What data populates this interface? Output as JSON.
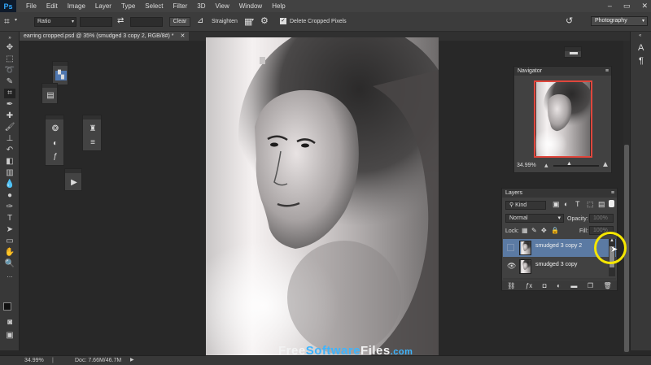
{
  "app": {
    "logo": "Ps"
  },
  "menu": [
    "File",
    "Edit",
    "Image",
    "Layer",
    "Type",
    "Select",
    "Filter",
    "3D",
    "View",
    "Window",
    "Help"
  ],
  "window_controls": [
    "–",
    "▭",
    "✕"
  ],
  "options_bar": {
    "ratio_select": "Ratio",
    "clear_label": "Clear",
    "straighten_label": "Straighten",
    "delete_cropped_label": "Delete Cropped Pixels",
    "delete_cropped_checked": true,
    "workspace": "Photography"
  },
  "document_tab": {
    "title": "earring cropped.psd @ 35% (smudged 3 copy 2, RGB/8#) *",
    "close": "✕"
  },
  "navigator": {
    "title": "Navigator",
    "zoom": "34.99%"
  },
  "layers": {
    "title": "Layers",
    "kind_filter": "Kind",
    "blend_mode": "Normal",
    "opacity_label": "Opacity:",
    "opacity_value": "100%",
    "lock_label": "Lock:",
    "fill_label": "Fill:",
    "fill_value": "100%",
    "rows": [
      {
        "name": "smudged 3 copy 2",
        "selected": true,
        "visible": false
      },
      {
        "name": "smudged 3 copy",
        "selected": false,
        "visible": true
      }
    ],
    "footer_icons": [
      "link-icon",
      "fx-icon",
      "mask-icon",
      "adjustment-icon",
      "folder-icon",
      "new-layer-icon",
      "trash-icon"
    ]
  },
  "status": {
    "zoom": "34.99%",
    "doc_size": "Doc: 7.66M/46.7M"
  },
  "watermark": {
    "part1": "Free",
    "part2": "Software",
    "part3": "Files",
    "part4": ".com"
  },
  "colors": {
    "selection": "#5b7aa3",
    "highlight": "#f5e600",
    "nav_frame": "#e0463c"
  }
}
